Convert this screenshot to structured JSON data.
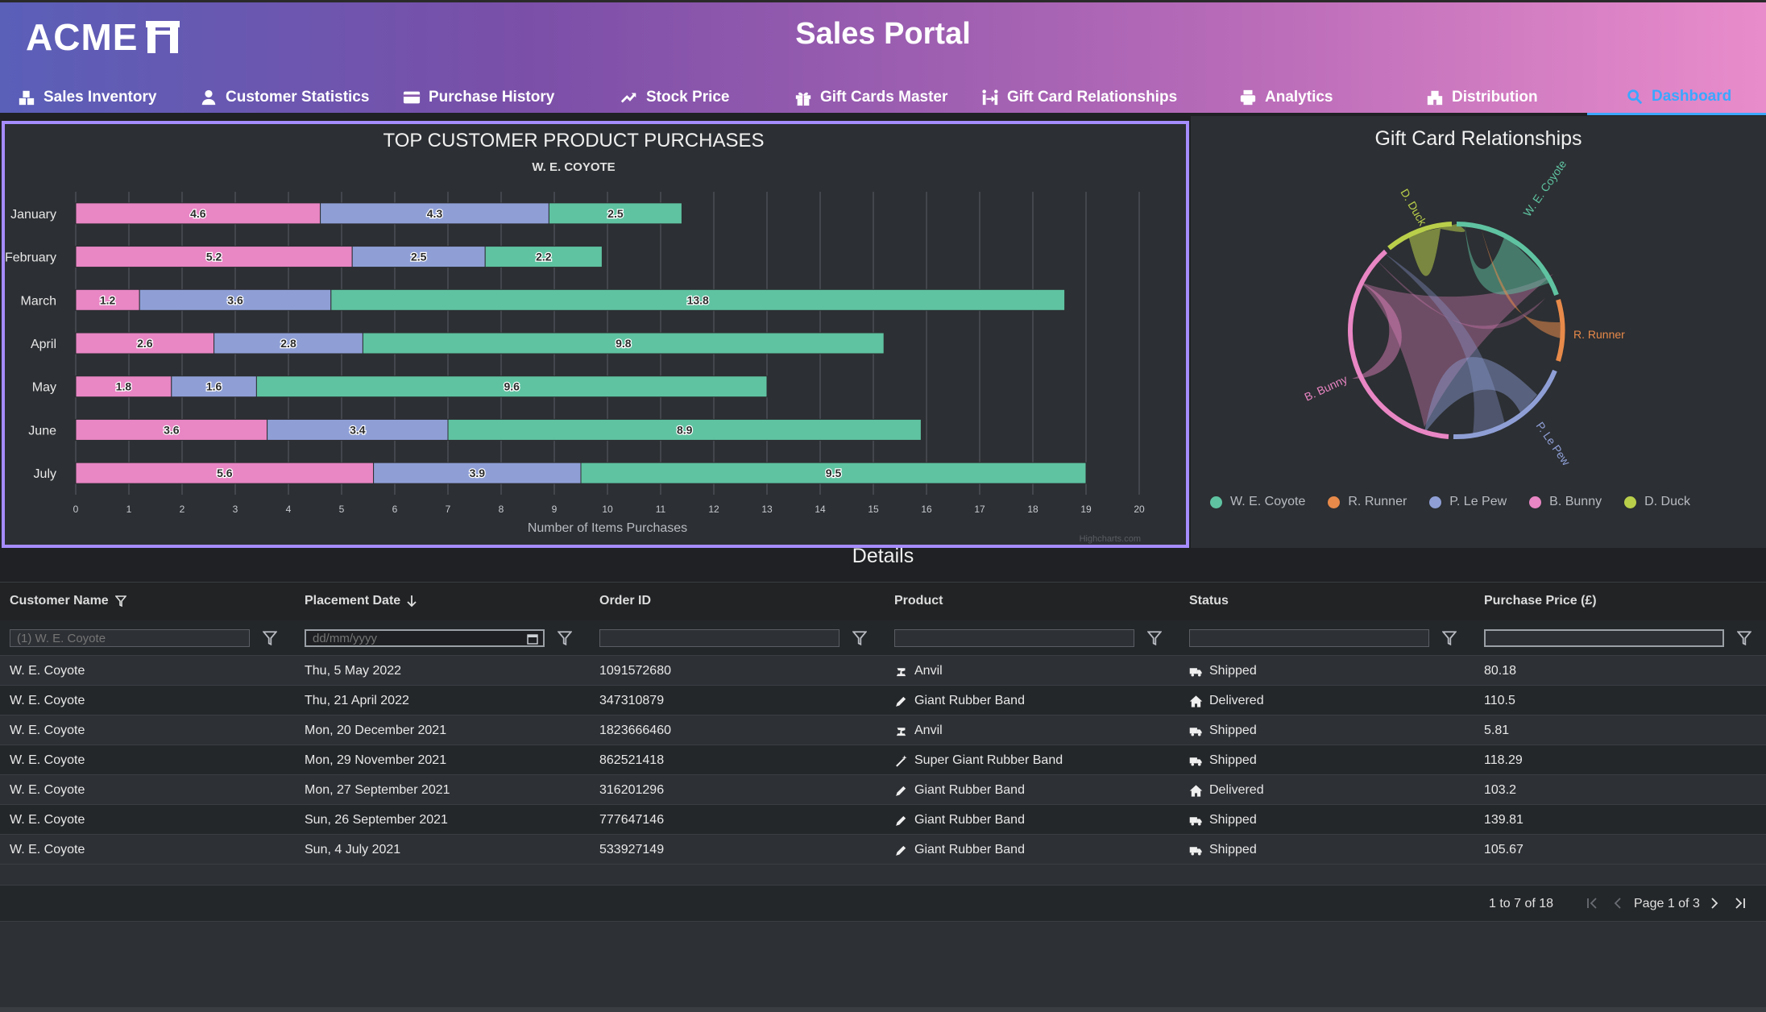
{
  "app": {
    "logo": "ACME",
    "title": "Sales Portal"
  },
  "nav": [
    {
      "label": "Sales Inventory",
      "icon": "boxes-icon"
    },
    {
      "label": "Customer Statistics",
      "icon": "user-icon"
    },
    {
      "label": "Purchase History",
      "icon": "credit-card-icon"
    },
    {
      "label": "Stock Price",
      "icon": "trend-up-icon"
    },
    {
      "label": "Gift Cards Master",
      "icon": "gift-icon"
    },
    {
      "label": "Gift Card Relationships",
      "icon": "people-arrows-icon"
    },
    {
      "label": "Analytics",
      "icon": "printer-icon"
    },
    {
      "label": "Distribution",
      "icon": "warehouse-icon"
    },
    {
      "label": "Dashboard",
      "icon": "search-icon",
      "active": true
    }
  ],
  "chart_data": {
    "type": "bar",
    "stacked": true,
    "orientation": "horizontal",
    "title": "TOP CUSTOMER PRODUCT PURCHASES",
    "subtitle": "W. E. COYOTE",
    "xlabel": "Number of Items Purchases",
    "categories": [
      "January",
      "February",
      "March",
      "April",
      "May",
      "June",
      "July"
    ],
    "xlim": [
      0,
      20
    ],
    "xticks": [
      0,
      1,
      2,
      3,
      4,
      5,
      6,
      7,
      8,
      9,
      10,
      11,
      12,
      13,
      14,
      15,
      16,
      17,
      18,
      19,
      20
    ],
    "series": [
      {
        "color": "#e986c4",
        "values": [
          4.6,
          5.2,
          1.2,
          2.6,
          1.8,
          3.6,
          5.6
        ]
      },
      {
        "color": "#8f9fd6",
        "values": [
          4.3,
          2.5,
          3.6,
          2.8,
          1.6,
          3.4,
          3.9
        ]
      },
      {
        "color": "#5fc3a1",
        "values": [
          2.5,
          2.2,
          13.8,
          9.8,
          9.6,
          8.9,
          9.5
        ]
      }
    ],
    "grid": true,
    "credit": "Highcharts.com"
  },
  "gift": {
    "title": "Gift Card Relationships",
    "nodes": [
      {
        "name": "W. E. Coyote",
        "color": "#5fc3a1"
      },
      {
        "name": "R. Runner",
        "color": "#e88a4a"
      },
      {
        "name": "P. Le Pew",
        "color": "#8f9fd6"
      },
      {
        "name": "B. Bunny",
        "color": "#e986c4"
      },
      {
        "name": "D. Duck",
        "color": "#b9cf4a"
      }
    ]
  },
  "details": {
    "title": "Details",
    "columns": [
      "Customer Name",
      "Placement Date",
      "Order ID",
      "Product",
      "Status",
      "Purchase Price (£)"
    ],
    "filters": {
      "customer_placeholder": "(1) W. E. Coyote",
      "date_placeholder": "dd/mm/yyyy"
    },
    "rows": [
      {
        "customer": "W. E. Coyote",
        "date": "Thu, 5 May 2022",
        "order": "1091572680",
        "product": "Anvil",
        "product_icon": "anvil-icon",
        "status": "Shipped",
        "status_icon": "truck-icon",
        "price": "80.18"
      },
      {
        "customer": "W. E. Coyote",
        "date": "Thu, 21 April 2022",
        "order": "347310879",
        "product": "Giant Rubber Band",
        "product_icon": "pencil-icon",
        "status": "Delivered",
        "status_icon": "house-icon",
        "price": "110.5"
      },
      {
        "customer": "W. E. Coyote",
        "date": "Mon, 20 December 2021",
        "order": "1823666460",
        "product": "Anvil",
        "product_icon": "anvil-icon",
        "status": "Shipped",
        "status_icon": "truck-icon",
        "price": "5.81"
      },
      {
        "customer": "W. E. Coyote",
        "date": "Mon, 29 November 2021",
        "order": "862521418",
        "product": "Super Giant Rubber Band",
        "product_icon": "magic-wand-icon",
        "status": "Shipped",
        "status_icon": "truck-icon",
        "price": "118.29"
      },
      {
        "customer": "W. E. Coyote",
        "date": "Mon, 27 September 2021",
        "order": "316201296",
        "product": "Giant Rubber Band",
        "product_icon": "pencil-icon",
        "status": "Delivered",
        "status_icon": "house-icon",
        "price": "103.2"
      },
      {
        "customer": "W. E. Coyote",
        "date": "Sun, 26 September 2021",
        "order": "777647146",
        "product": "Giant Rubber Band",
        "product_icon": "pencil-icon",
        "status": "Shipped",
        "status_icon": "truck-icon",
        "price": "139.81"
      },
      {
        "customer": "W. E. Coyote",
        "date": "Sun, 4 July 2021",
        "order": "533927149",
        "product": "Giant Rubber Band",
        "product_icon": "pencil-icon",
        "status": "Shipped",
        "status_icon": "truck-icon",
        "price": "105.67"
      }
    ],
    "pager": {
      "summary": "1 to 7 of 18",
      "page": "Page 1 of 3"
    }
  }
}
